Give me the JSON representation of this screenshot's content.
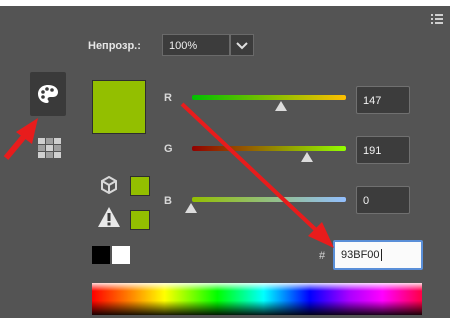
{
  "window": {
    "menu_icon": "panel-menu-icon"
  },
  "opacity": {
    "label": "Непрозр.:",
    "value": "100%"
  },
  "sidebar": {
    "active_icon": "palette-icon",
    "second_icon": "swatches-grid-icon"
  },
  "color": {
    "current_hex_color": "#93BF00",
    "hex_value": "93BF00",
    "hash_label": "#"
  },
  "channels": [
    {
      "label": "R",
      "value": "147",
      "level": 0.576
    },
    {
      "label": "G",
      "value": "191",
      "level": 0.749
    },
    {
      "label": "B",
      "value": "0",
      "level": 0.0
    }
  ],
  "gamut": {
    "cube_icon": "web-safe-cube-icon",
    "warning_icon": "out-of-gamut-warning-icon"
  },
  "annotations": {
    "arrow_color": "#e81c1c"
  }
}
